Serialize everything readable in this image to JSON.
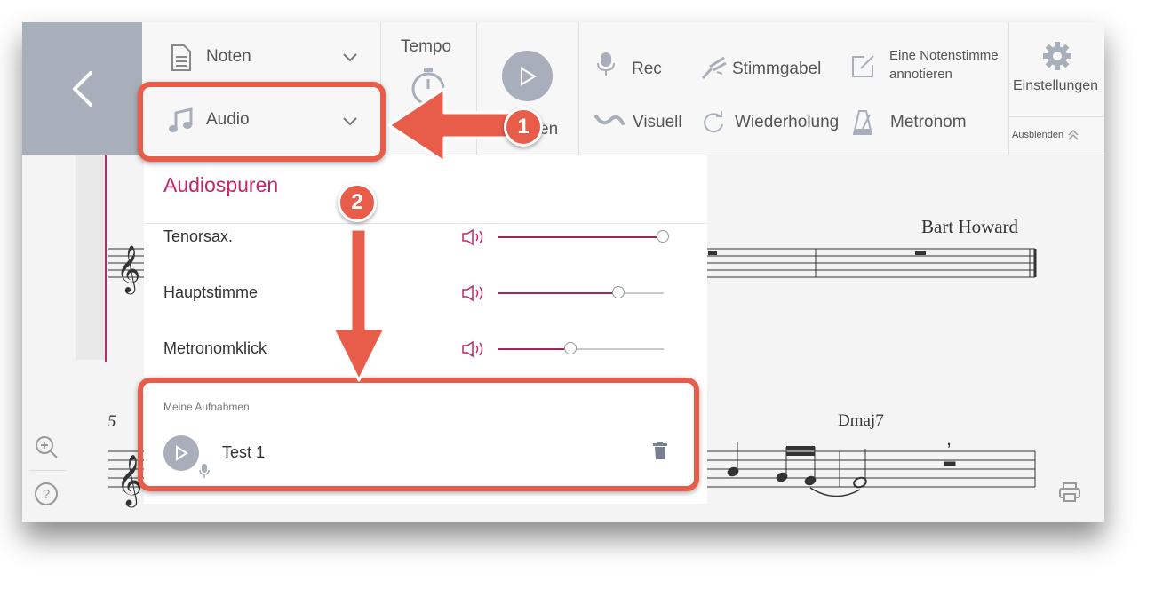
{
  "toolbar": {
    "noten_label": "Noten",
    "audio_label": "Audio",
    "tempo_label": "Tempo",
    "play_label_partial": "en",
    "rec_label": "Rec",
    "stimmgabel_label": "Stimmgabel",
    "annotate_label_1": "Eine Notenstimme",
    "annotate_label_2": "annotieren",
    "einstellungen_label": "Einstellungen",
    "visuell_label": "Visuell",
    "wiederholung_label": "Wiederholung",
    "metronom_label": "Metronom",
    "ausblenden_label": "Ausblenden"
  },
  "audio_panel": {
    "title": "Audiospuren",
    "tracks": [
      {
        "label": "Tenorsax.",
        "volume": 1.0
      },
      {
        "label": "Hauptstimme",
        "volume": 0.73
      },
      {
        "label": "Metronomklick",
        "volume": 0.44
      }
    ],
    "recordings_heading": "Meine Aufnahmen",
    "recordings": [
      {
        "label": "Test 1"
      }
    ]
  },
  "score": {
    "composer": "Bart Howard",
    "measure_number": "5",
    "chord": "Dmaj7"
  },
  "callouts": {
    "badge_1": "1",
    "badge_2": "2"
  },
  "colors": {
    "accent": "#c0266a",
    "callout": "#e85c4a",
    "back_panel": "#a9afba"
  },
  "icons": [
    "chevron-left-icon",
    "document-icon",
    "chevron-down-icon",
    "music-note-icon",
    "stopwatch-icon",
    "play-icon",
    "microphone-icon",
    "tuning-fork-icon",
    "pencil-square-icon",
    "gear-icon",
    "wave-icon",
    "refresh-icon",
    "metronome-icon",
    "double-chevron-up-icon",
    "speaker-icon",
    "trash-icon",
    "zoom-in-icon",
    "help-icon",
    "print-icon"
  ]
}
